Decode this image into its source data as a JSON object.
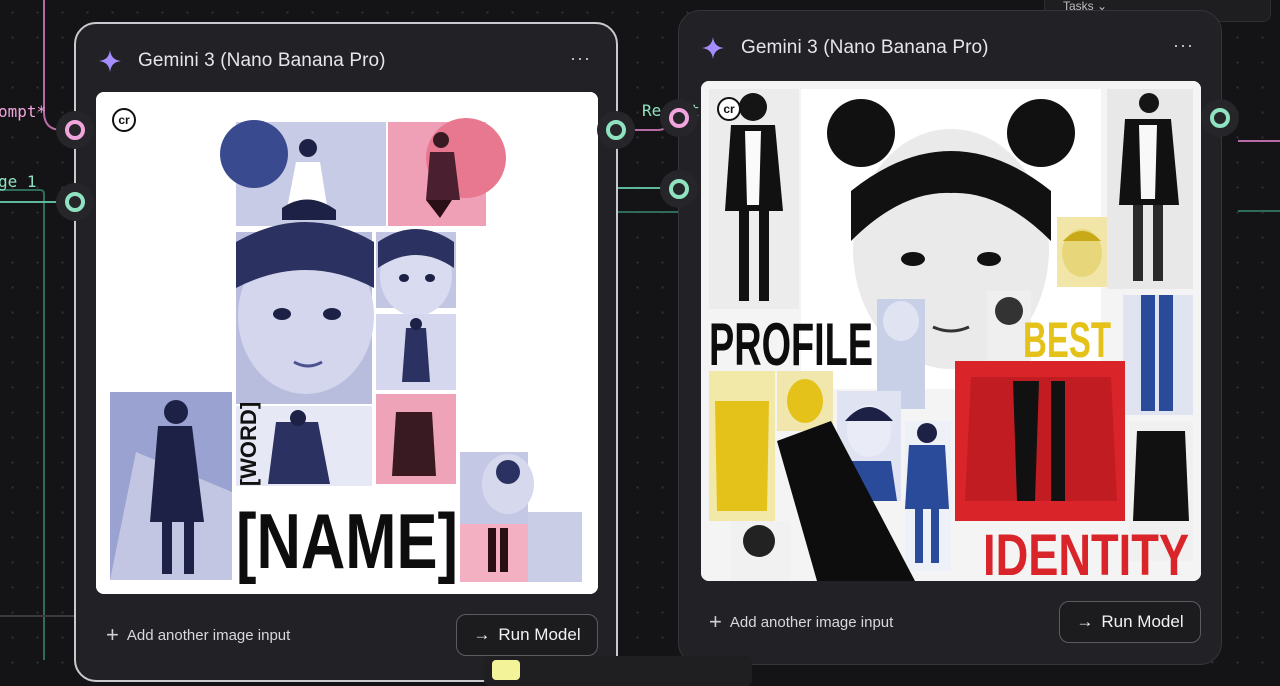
{
  "window": {
    "tasks_label": "Tasks"
  },
  "ports": {
    "prompt_label": "ompt*",
    "image_label": "ge 1",
    "result_label": "Result"
  },
  "colors": {
    "prompt_port": "#f0a5dd",
    "image_port": "#8fe3c0",
    "result_port": "#8fe3c0",
    "accent_star": "#a58cff"
  },
  "node_left": {
    "title": "Gemini 3 (Nano Banana Pro)",
    "menu_icon": "ellipsis-icon",
    "add_input_label": "Add another image input",
    "run_label": "Run Model",
    "image": {
      "logo": "cr",
      "word_label": "[WORD]",
      "name_label": "[NAME]"
    }
  },
  "node_right": {
    "title": "Gemini 3 (Nano Banana Pro)",
    "menu_icon": "ellipsis-icon",
    "add_input_label": "Add another image input",
    "run_label": "Run Model",
    "image": {
      "logo": "cr",
      "profile_label": "PROFILE",
      "best_label": "BEST",
      "identity_label": "IDENTITY"
    }
  }
}
